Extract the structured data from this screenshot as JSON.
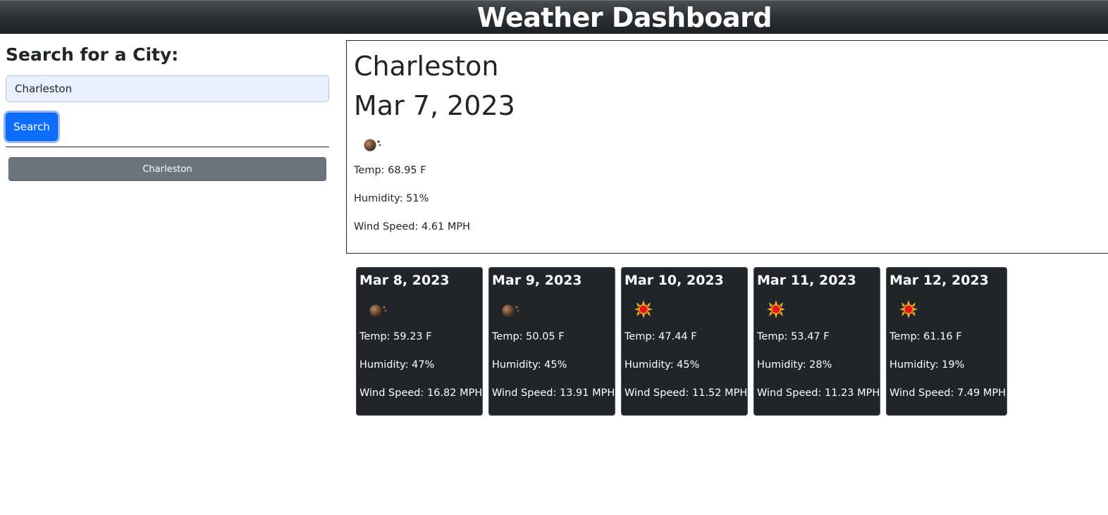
{
  "header": {
    "title": "Weather Dashboard"
  },
  "sidebar": {
    "heading": "Search for a City:",
    "search_value": "Charleston",
    "search_button_label": "Search",
    "history": [
      "Charleston"
    ]
  },
  "current": {
    "city": "Charleston",
    "date": "Mar 7, 2023",
    "icon": "overcast-cloud-icon",
    "temp": "Temp: 68.95 F",
    "humidity": "Humidity: 51%",
    "wind": "Wind Speed: 4.61 MPH"
  },
  "forecast": [
    {
      "date": "Mar 8, 2023",
      "icon": "cloud-icon",
      "temp": "Temp: 59.23 F",
      "humidity": "Humidity: 47%",
      "wind": "Wind Speed: 16.82 MPH"
    },
    {
      "date": "Mar 9, 2023",
      "icon": "cloud-icon",
      "temp": "Temp: 50.05 F",
      "humidity": "Humidity: 45%",
      "wind": "Wind Speed: 13.91 MPH"
    },
    {
      "date": "Mar 10, 2023",
      "icon": "sun-icon",
      "temp": "Temp: 47.44 F",
      "humidity": "Humidity: 45%",
      "wind": "Wind Speed: 11.52 MPH"
    },
    {
      "date": "Mar 11, 2023",
      "icon": "sun-icon",
      "temp": "Temp: 53.47 F",
      "humidity": "Humidity: 28%",
      "wind": "Wind Speed: 11.23 MPH"
    },
    {
      "date": "Mar 12, 2023",
      "icon": "sun-icon",
      "temp": "Temp: 61.16 F",
      "humidity": "Humidity: 19%",
      "wind": "Wind Speed: 7.49 MPH"
    }
  ],
  "colors": {
    "search_button": "#0d6efd",
    "history_button": "#6c757d",
    "card_background": "#212529"
  }
}
